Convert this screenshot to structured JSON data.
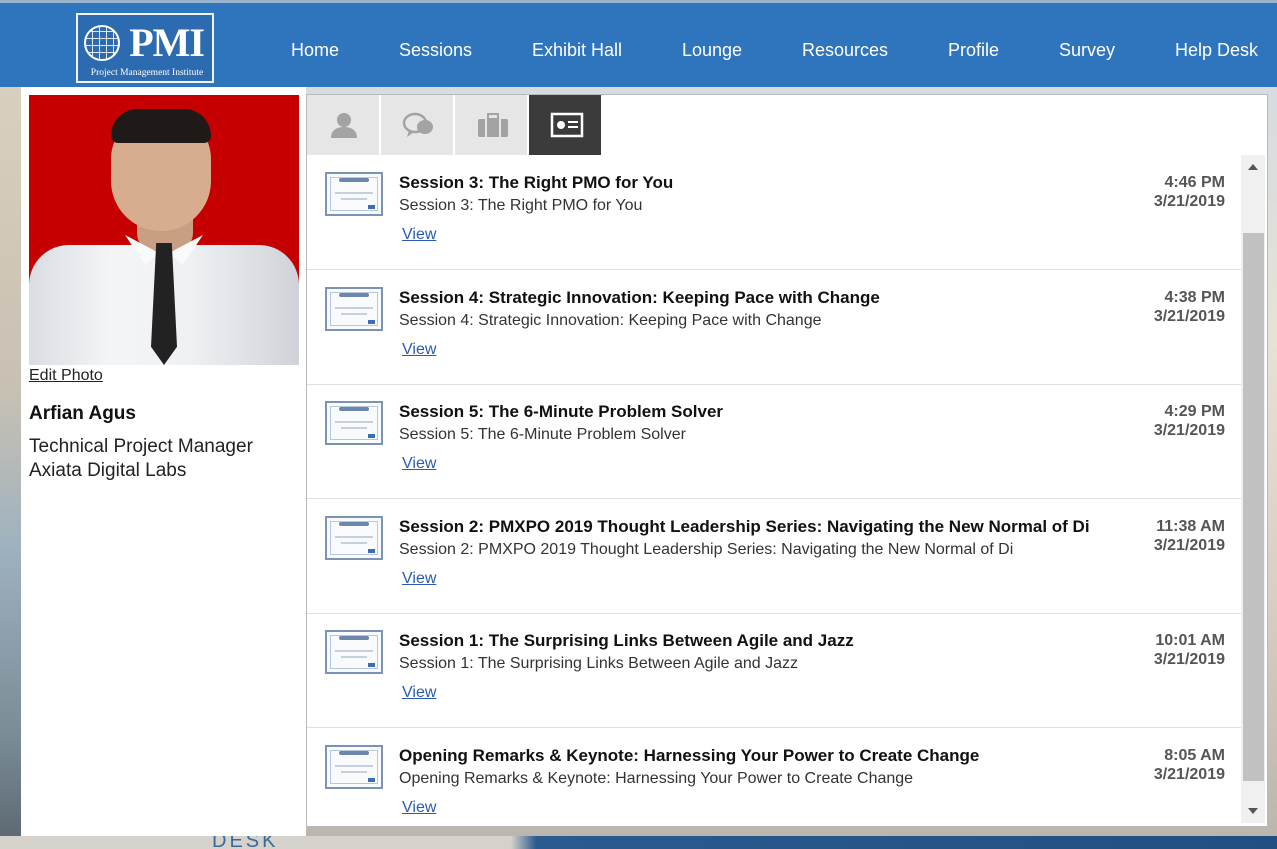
{
  "header": {
    "logo_text": "PMI",
    "logo_subtitle": "Project Management Institute",
    "nav": [
      {
        "label": "Home"
      },
      {
        "label": "Sessions"
      },
      {
        "label": "Exhibit Hall"
      },
      {
        "label": "Lounge"
      },
      {
        "label": "Resources"
      },
      {
        "label": "Profile"
      },
      {
        "label": "Survey"
      },
      {
        "label": "Help Desk"
      }
    ]
  },
  "profile": {
    "edit_photo_label": "Edit Photo",
    "name": "Arfian Agus",
    "title": "Technical Project Manager",
    "company": "Axiata Digital Labs"
  },
  "tabs": [
    {
      "icon": "person-icon",
      "active": false
    },
    {
      "icon": "chat-bubbles-icon",
      "active": false
    },
    {
      "icon": "briefcase-icon",
      "active": false
    },
    {
      "icon": "certificate-icon",
      "active": true
    }
  ],
  "certificates": [
    {
      "title": "Session 3: The Right PMO for You",
      "subtitle": "Session 3: The Right PMO for You",
      "link": "View",
      "time": "4:46 PM",
      "date": "3/21/2019"
    },
    {
      "title": "Session 4: Strategic Innovation: Keeping Pace with Change",
      "subtitle": "Session 4: Strategic Innovation: Keeping Pace with Change",
      "link": "View",
      "time": "4:38 PM",
      "date": "3/21/2019"
    },
    {
      "title": "Session 5: The 6-Minute Problem Solver",
      "subtitle": "Session 5: The 6-Minute Problem Solver",
      "link": "View",
      "time": "4:29 PM",
      "date": "3/21/2019"
    },
    {
      "title": "Session 2: PMXPO 2019 Thought Leadership Series: Navigating the New Normal of Di",
      "subtitle": "Session 2: PMXPO 2019 Thought Leadership Series: Navigating the New Normal of Di",
      "link": "View",
      "time": "11:38 AM",
      "date": "3/21/2019"
    },
    {
      "title": "Session 1: The Surprising Links Between Agile and Jazz",
      "subtitle": "Session 1: The Surprising Links Between Agile and Jazz",
      "link": "View",
      "time": "10:01 AM",
      "date": "3/21/2019"
    },
    {
      "title": "Opening Remarks & Keynote: Harnessing Your Power to Create Change",
      "subtitle": "Opening Remarks & Keynote: Harnessing Your Power to Create Change",
      "link": "View",
      "time": "8:05 AM",
      "date": "3/21/2019"
    }
  ],
  "background_text": "DESK",
  "colors": {
    "nav_bar": "#2f75bd",
    "photo_background": "#c60000",
    "link": "#2a5bb0",
    "active_tab": "#3b3b3b"
  }
}
